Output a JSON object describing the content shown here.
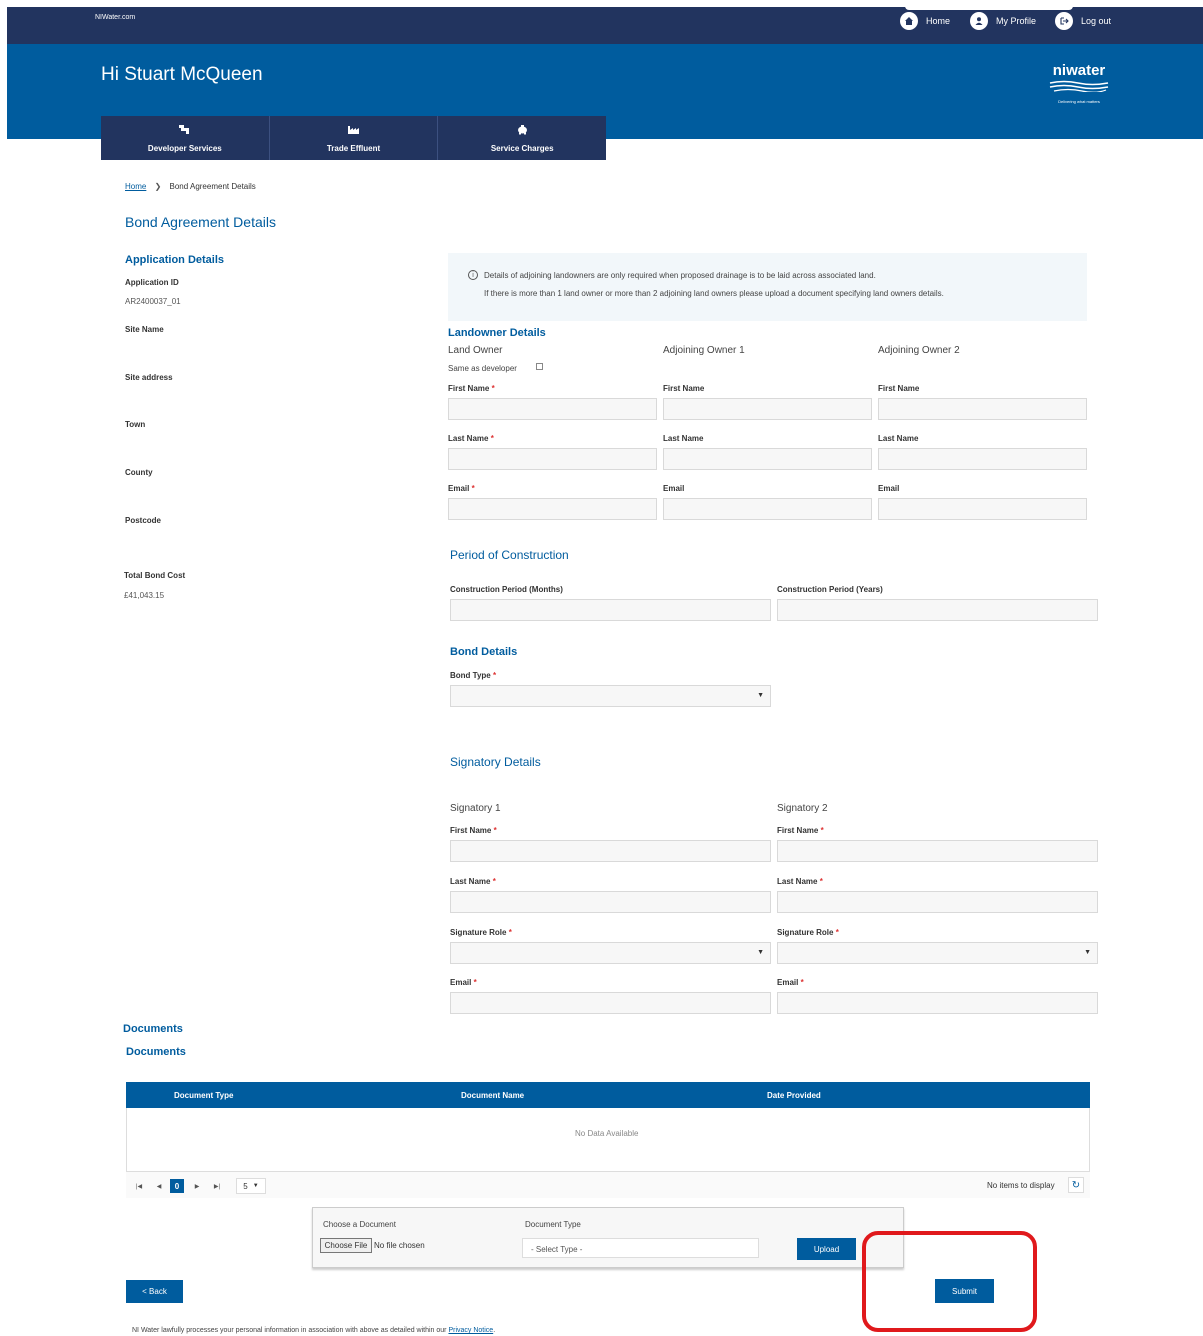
{
  "header": {
    "site": "NIWater.com",
    "nav": {
      "home": "Home",
      "profile": "My Profile",
      "logout": "Log out"
    },
    "greeting": "Hi Stuart McQueen",
    "logo": {
      "word": "niwater",
      "tagline": "Delivering what matters"
    }
  },
  "main_nav": [
    {
      "label": "Developer Services",
      "icon": "pipe-icon"
    },
    {
      "label": "Trade Effluent",
      "icon": "factory-icon"
    },
    {
      "label": "Service Charges",
      "icon": "piggy-bank-icon"
    }
  ],
  "breadcrumb": {
    "home": "Home",
    "current": "Bond Agreement Details"
  },
  "page_title": "Bond Agreement Details",
  "application": {
    "heading": "Application Details",
    "id_label": "Application ID",
    "id_value": "AR2400037_01",
    "site_name_label": "Site Name",
    "site_address_label": "Site address",
    "town_label": "Town",
    "county_label": "County",
    "postcode_label": "Postcode",
    "total_cost_label": "Total Bond Cost",
    "total_cost_value": "£41,043.15"
  },
  "info": {
    "line1": "Details of adjoining landowners are only required when proposed drainage is to be laid across associated land.",
    "line2": "If there is more than 1 land owner or more than 2 adjoining land owners please upload a document specifying land owners details."
  },
  "landowner": {
    "heading": "Landowner Details",
    "land_owner": "Land Owner",
    "adjoining1": "Adjoining Owner 1",
    "adjoining2": "Adjoining Owner 2",
    "same_as_developer": "Same as developer",
    "first_name": "First Name",
    "last_name": "Last Name",
    "email": "Email",
    "required": "*"
  },
  "construction": {
    "heading": "Period of Construction",
    "months": "Construction Period (Months)",
    "years": "Construction Period (Years)"
  },
  "bond": {
    "heading": "Bond Details",
    "type": "Bond Type"
  },
  "signatory": {
    "heading": "Signatory Details",
    "s1": "Signatory 1",
    "s2": "Signatory 2",
    "first_name": "First Name",
    "last_name": "Last Name",
    "role": "Signature Role",
    "email": "Email"
  },
  "documents": {
    "heading1": "Documents",
    "heading2": "Documents",
    "col_type": "Document Type",
    "col_name": "Document Name",
    "col_date": "Date Provided",
    "no_data": "No Data Available",
    "page": "0",
    "page_size": "5",
    "no_items": "No items to display"
  },
  "upload": {
    "choose_label": "Choose a Document",
    "choose_btn": "Choose File",
    "no_file": "No file chosen",
    "type_label": "Document Type",
    "type_placeholder": "- Select Type -",
    "upload_btn": "Upload"
  },
  "actions": {
    "back": "< Back",
    "submit": "Submit"
  },
  "footer": {
    "text": "NI Water lawfully processes your personal information in association with above as detailed within our ",
    "link": "Privacy Notice",
    "end": "."
  },
  "colors": {
    "primary": "#005c9e",
    "navy": "#22345f",
    "highlight": "#e0191c"
  }
}
